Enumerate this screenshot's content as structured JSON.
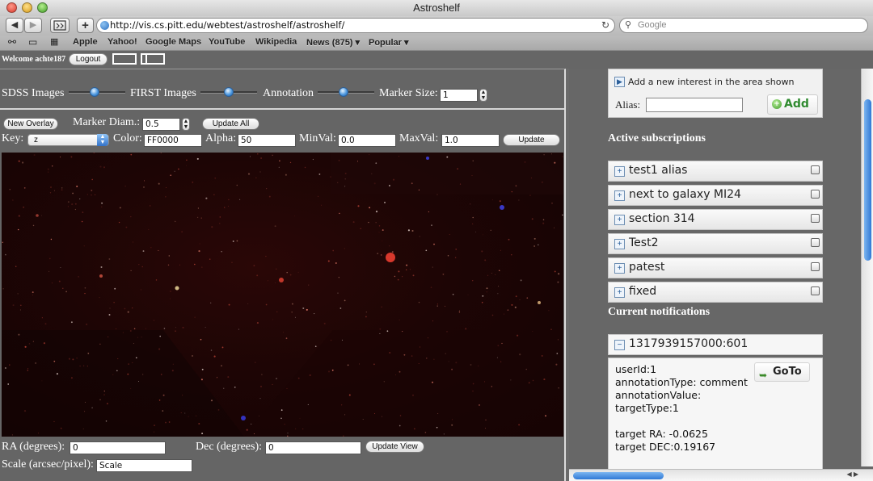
{
  "window": {
    "title": "Astroshelf"
  },
  "toolbar": {
    "back_glyph": "◀",
    "forward_glyph": "▶",
    "add_glyph": "+",
    "url": "http://vis.cs.pitt.edu/webtest/astroshelf/astroshelf/",
    "search_placeholder": "Google",
    "reload_icon": "↻"
  },
  "bookmarks": {
    "items": [
      "Apple",
      "Yahoo!",
      "Google Maps",
      "YouTube",
      "Wikipedia",
      "News (875) ▾",
      "Popular ▾"
    ]
  },
  "header": {
    "welcome": "Welcome achte187",
    "logout_label": "Logout"
  },
  "layers": {
    "sdss_label": "SDSS Images",
    "sdss_level": 0.45,
    "first_label": "FIRST Images",
    "first_level": 0.5,
    "annotation_label": "Annotation",
    "annotation_level": 0.45,
    "marker_size_label": "Marker Size:",
    "marker_size_value": "1"
  },
  "overlay": {
    "new_overlay_label": "New Overlay",
    "marker_diam_label": "Marker Diam.:",
    "marker_diam_value": "0.5",
    "update_all_label": "Update All",
    "key_label": "Key:",
    "key_value": "z",
    "color_label": "Color:",
    "color_value": "FF0000",
    "alpha_label": "Alpha:",
    "alpha_value": "50",
    "minval_label": "MinVal:",
    "minval_value": "0.0",
    "maxval_label": "MaxVal:",
    "maxval_value": "1.0",
    "update_label": "Update"
  },
  "coords": {
    "ra_label": "RA (degrees):",
    "ra_value": "0",
    "dec_label": "Dec (degrees):",
    "dec_value": "0",
    "update_view_label": "Update View",
    "scale_label": "Scale (arcsec/pixel):",
    "scale_value": "Scale"
  },
  "interest": {
    "title": "Add a new interest in the area shown",
    "alias_label": "Alias:",
    "add_label": "Add"
  },
  "subscriptions": {
    "heading": "Active subscriptions",
    "items": [
      {
        "label": "test1 alias"
      },
      {
        "label": "next to galaxy MI24"
      },
      {
        "label": "section 314"
      },
      {
        "label": "Test2"
      },
      {
        "label": "patest"
      },
      {
        "label": "fixed"
      }
    ]
  },
  "notifications": {
    "heading": "Current notifications",
    "id": "1317939157000:601",
    "goto_label": "GoTo",
    "lines": [
      "userId:1",
      "annotationType: comment",
      "annotationValue:",
      "targetType:1",
      "",
      "target RA: -0.0625",
      "target DEC:0.19167"
    ]
  }
}
